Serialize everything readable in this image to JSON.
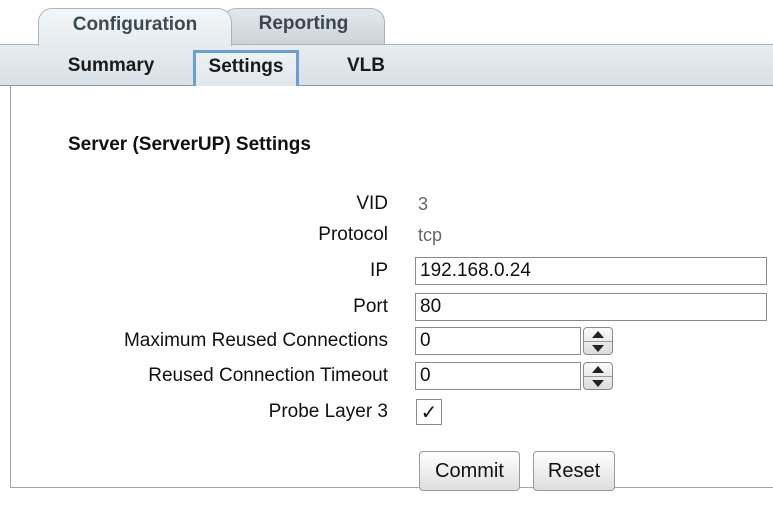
{
  "tabs": [
    {
      "label": "Configuration",
      "active": true
    },
    {
      "label": "Reporting",
      "active": false
    }
  ],
  "subtabs": [
    {
      "label": "Summary",
      "active": false
    },
    {
      "label": "Settings",
      "active": true
    },
    {
      "label": "VLB",
      "active": false
    }
  ],
  "section": {
    "title": "Server (ServerUP) Settings"
  },
  "fields": {
    "vid": {
      "label": "VID",
      "value": "3"
    },
    "protocol": {
      "label": "Protocol",
      "value": "tcp"
    },
    "ip": {
      "label": "IP",
      "value": "192.168.0.24"
    },
    "port": {
      "label": "Port",
      "value": "80"
    },
    "max_reused": {
      "label": "Maximum Reused Connections",
      "value": "0"
    },
    "reused_timeout": {
      "label": "Reused Connection Timeout",
      "value": "0"
    },
    "probe_layer3": {
      "label": "Probe Layer 3",
      "checked": true,
      "mark": "✓"
    }
  },
  "buttons": {
    "commit": "Commit",
    "reset": "Reset"
  },
  "colors": {
    "active_subtab_border": "#6a9fd0",
    "tab_text": "#3d4a55"
  }
}
